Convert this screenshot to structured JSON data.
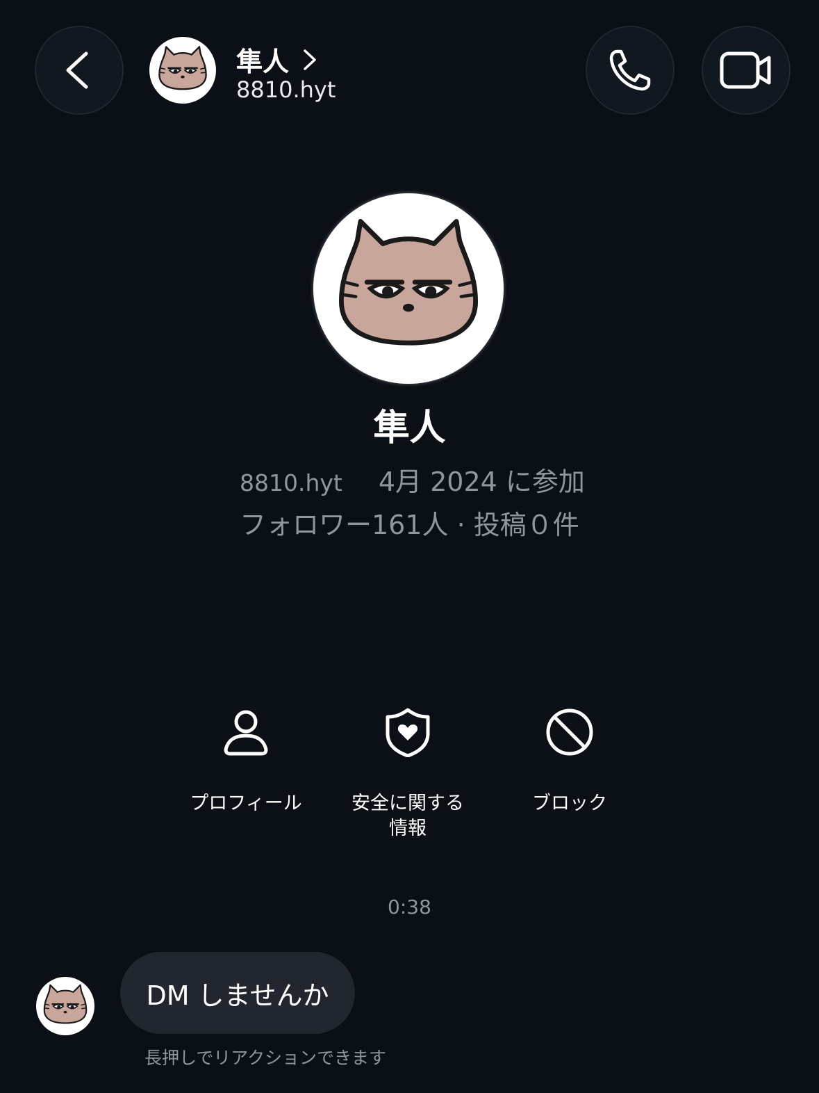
{
  "header": {
    "name": "隼人",
    "handle": "8810.hyt"
  },
  "profile": {
    "name": "隼人",
    "handle": "8810.hyt",
    "joined": "4月 2024 に参加",
    "stats": "フォロワー161人 · 投稿０件"
  },
  "actions": {
    "profile_label": "プロフィール",
    "safety_label": "安全に関する\n情報",
    "block_label": "ブロック"
  },
  "chat": {
    "timestamp": "0:38",
    "message": "DM しませんか",
    "hint": "長押しでリアクションできます"
  },
  "icons": {
    "back": "chevron-left-icon",
    "call": "phone-icon",
    "video": "video-camera-icon",
    "header_chevron": "chevron-right-icon",
    "profile": "person-icon",
    "safety": "shield-heart-icon",
    "block": "block-icon"
  },
  "colors": {
    "background": "#0b1016",
    "secondary_text": "#8f969e",
    "bubble": "#22272f",
    "avatar_cat": "#c9a69b"
  }
}
